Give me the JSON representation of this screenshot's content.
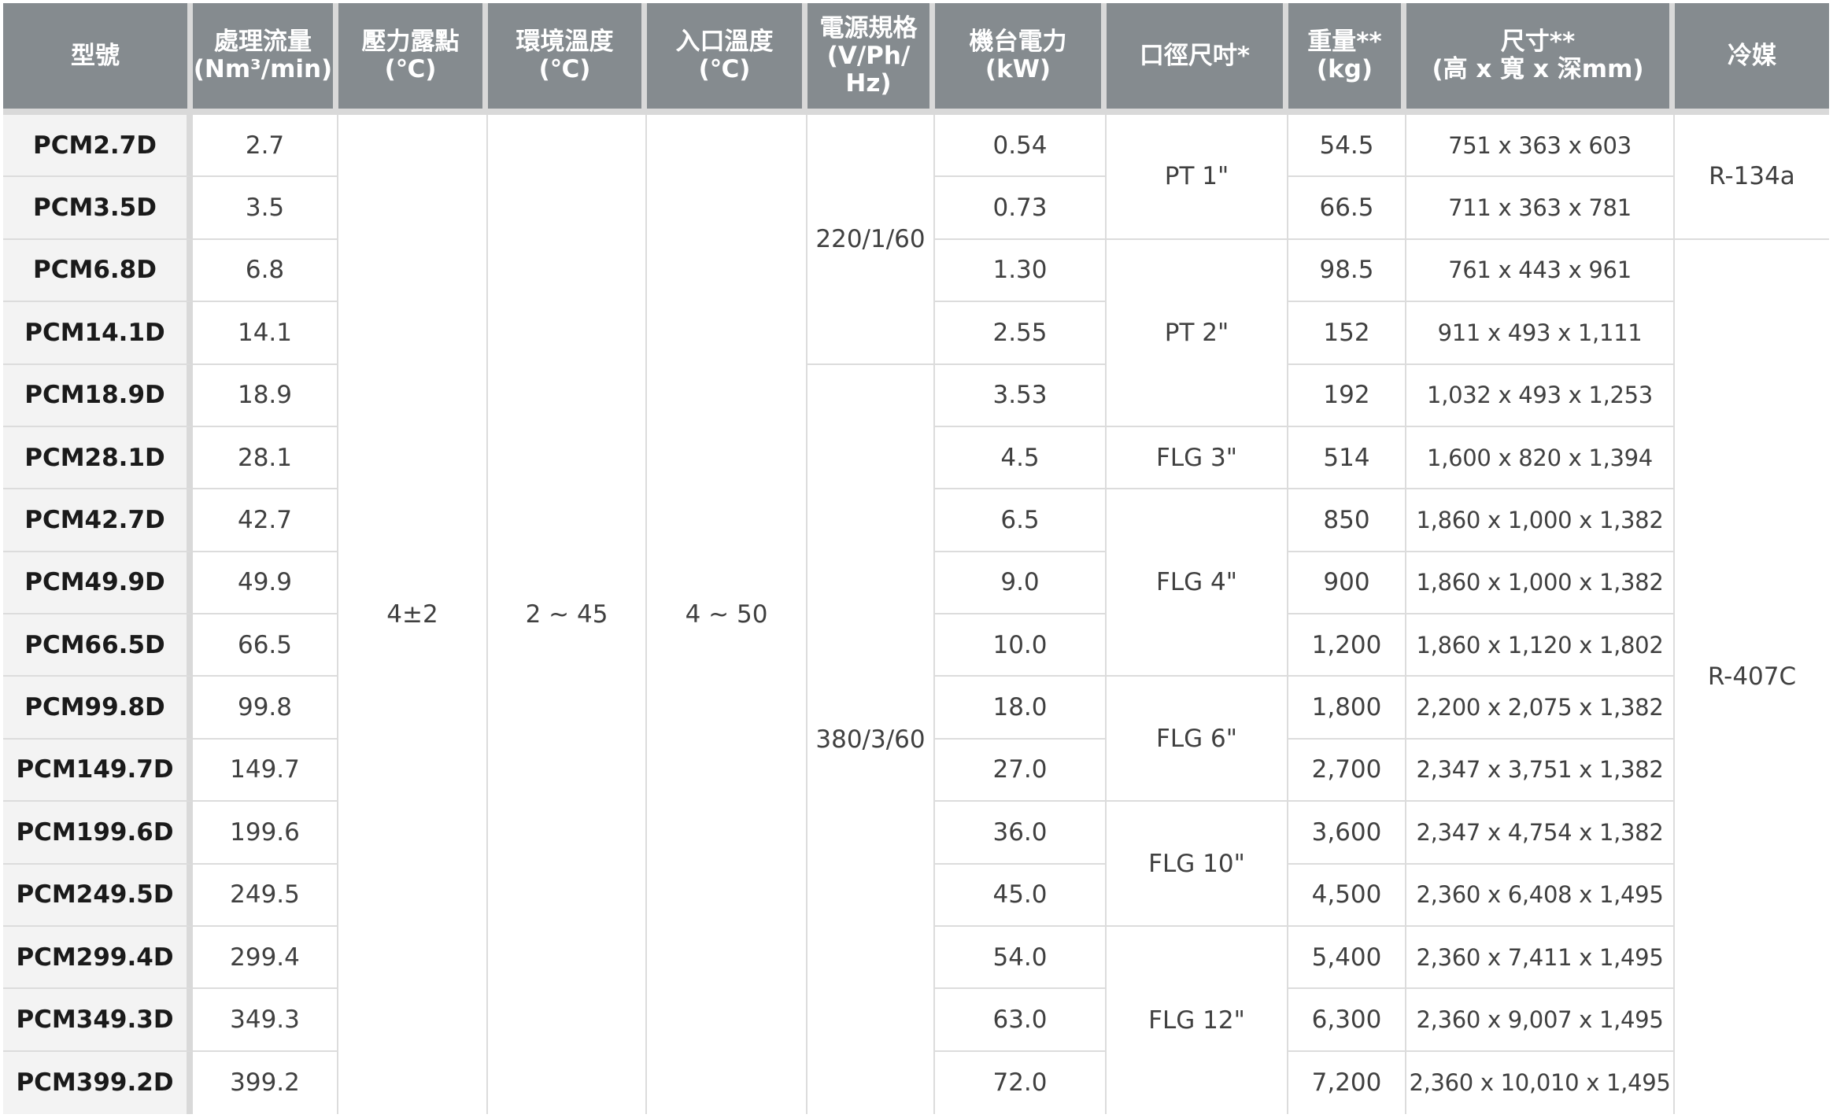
{
  "headers": {
    "model": "型號",
    "flow": "處理流量\n(Nm³/min)",
    "dewpoint": "壓力露點\n(℃)",
    "ambient": "環境溫度\n(℃)",
    "inlet": "入口溫度\n(℃)",
    "power_spec": "電源規格\n(V/Ph/\nHz)",
    "power": "機台電力\n(kW)",
    "port": "口徑尺吋*",
    "weight": "重量**\n(kg)",
    "dimensions": "尺寸**\n(高 x 寬 x 深mm)",
    "refrigerant": "冷媒"
  },
  "rows": [
    {
      "model": "PCM2.7D",
      "flow": "2.7",
      "power": "0.54",
      "weight": "54.5",
      "dimensions": "751 x 363 x 603"
    },
    {
      "model": "PCM3.5D",
      "flow": "3.5",
      "power": "0.73",
      "weight": "66.5",
      "dimensions": "711 x 363 x 781"
    },
    {
      "model": "PCM6.8D",
      "flow": "6.8",
      "power": "1.30",
      "weight": "98.5",
      "dimensions": "761 x 443 x 961"
    },
    {
      "model": "PCM14.1D",
      "flow": "14.1",
      "power": "2.55",
      "weight": "152",
      "dimensions": "911 x 493 x 1,111"
    },
    {
      "model": "PCM18.9D",
      "flow": "18.9",
      "power": "3.53",
      "weight": "192",
      "dimensions": "1,032 x 493 x 1,253"
    },
    {
      "model": "PCM28.1D",
      "flow": "28.1",
      "power": "4.5",
      "weight": "514",
      "dimensions": "1,600 x 820 x 1,394"
    },
    {
      "model": "PCM42.7D",
      "flow": "42.7",
      "power": "6.5",
      "weight": "850",
      "dimensions": "1,860 x 1,000 x 1,382"
    },
    {
      "model": "PCM49.9D",
      "flow": "49.9",
      "power": "9.0",
      "weight": "900",
      "dimensions": "1,860 x 1,000 x 1,382"
    },
    {
      "model": "PCM66.5D",
      "flow": "66.5",
      "power": "10.0",
      "weight": "1,200",
      "dimensions": "1,860 x 1,120 x 1,802"
    },
    {
      "model": "PCM99.8D",
      "flow": "99.8",
      "power": "18.0",
      "weight": "1,800",
      "dimensions": "2,200 x 2,075 x 1,382"
    },
    {
      "model": "PCM149.7D",
      "flow": "149.7",
      "power": "27.0",
      "weight": "2,700",
      "dimensions": "2,347 x 3,751 x 1,382"
    },
    {
      "model": "PCM199.6D",
      "flow": "199.6",
      "power": "36.0",
      "weight": "3,600",
      "dimensions": "2,347 x 4,754 x 1,382"
    },
    {
      "model": "PCM249.5D",
      "flow": "249.5",
      "power": "45.0",
      "weight": "4,500",
      "dimensions": "2,360 x 6,408 x 1,495"
    },
    {
      "model": "PCM299.4D",
      "flow": "299.4",
      "power": "54.0",
      "weight": "5,400",
      "dimensions": "2,360 x 7,411 x 1,495"
    },
    {
      "model": "PCM349.3D",
      "flow": "349.3",
      "power": "63.0",
      "weight": "6,300",
      "dimensions": "2,360 x 9,007 x 1,495"
    },
    {
      "model": "PCM399.2D",
      "flow": "399.2",
      "power": "72.0",
      "weight": "7,200",
      "dimensions": "2,360 x 10,010 x 1,495"
    }
  ],
  "shared": {
    "dewpoint": "4±2",
    "ambient": "2 ~ 45",
    "inlet": "4 ~ 50",
    "power_spec_a": "220/1/60",
    "power_spec_b": "380/3/60",
    "refrigerant_a": "R-134a",
    "refrigerant_b": "R-407C"
  },
  "ports": [
    {
      "label": "PT 1\"",
      "rows": 2
    },
    {
      "label": "PT 2\"",
      "rows": 3
    },
    {
      "label": "FLG 3\"",
      "rows": 1
    },
    {
      "label": "FLG 4\"",
      "rows": 3
    },
    {
      "label": "FLG 6\"",
      "rows": 2
    },
    {
      "label": "FLG 10\"",
      "rows": 2
    },
    {
      "label": "FLG 12\"",
      "rows": 3
    }
  ],
  "colors": {
    "header_bg": "#858b8f",
    "header_text": "#ffffff",
    "model_col_bg": "#f3f3f3",
    "grid_line": "#dcdcdc"
  }
}
